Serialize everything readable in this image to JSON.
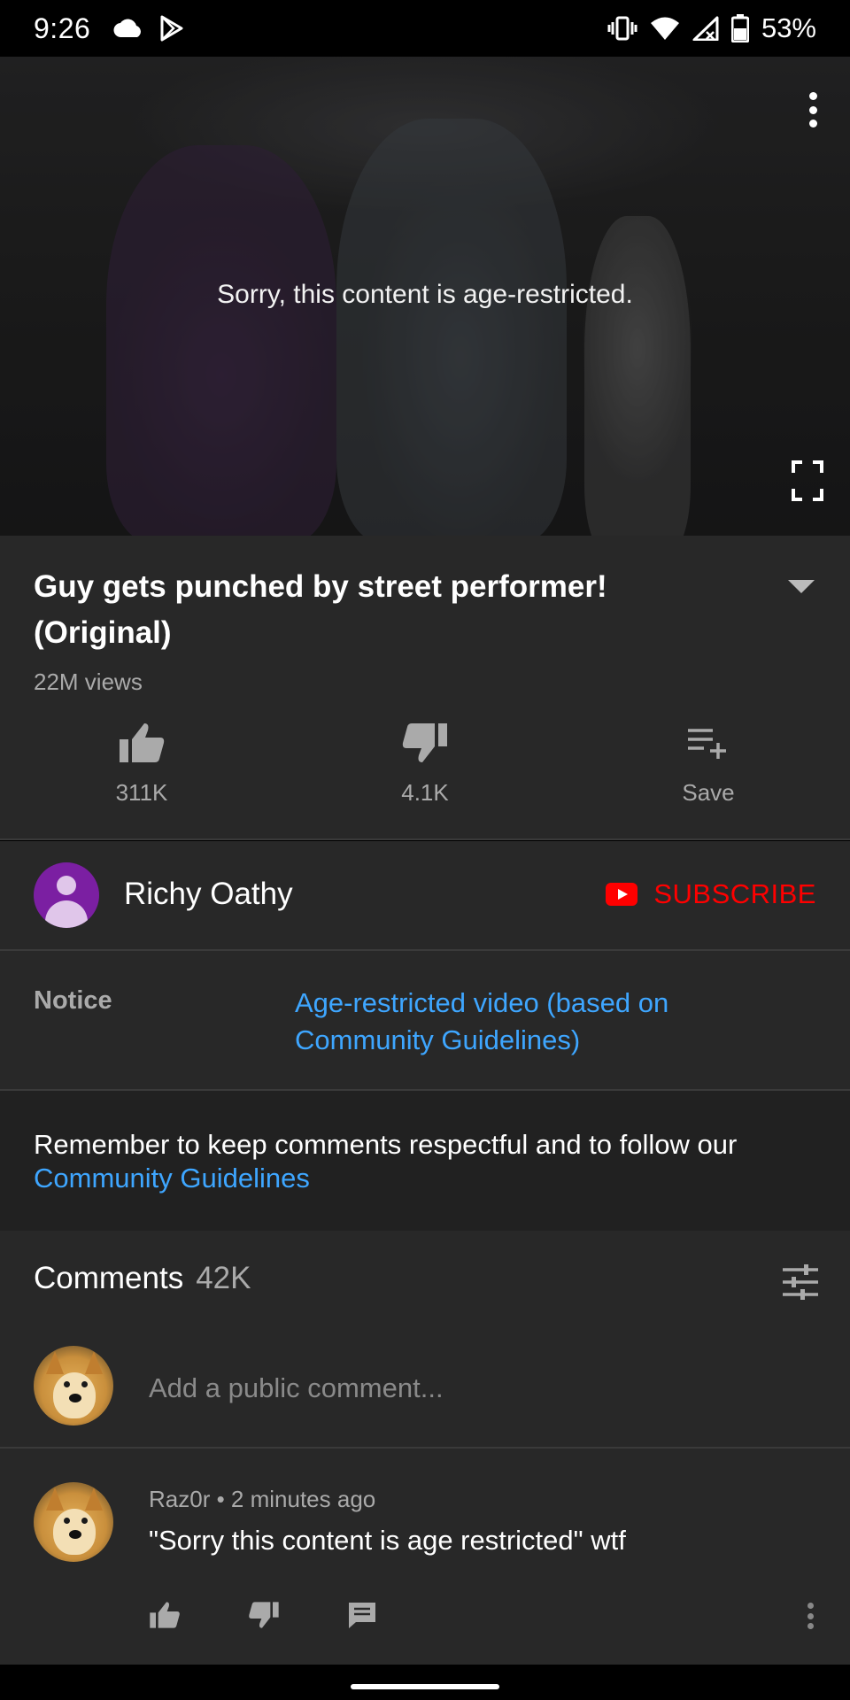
{
  "status_bar": {
    "time": "9:26",
    "battery": "53%",
    "icons": [
      "cloud-icon",
      "play-store-icon",
      "vibrate-icon",
      "wifi-icon",
      "signal-icon",
      "battery-icon"
    ]
  },
  "player": {
    "message": "Sorry, this content is age-restricted."
  },
  "video": {
    "title": "Guy gets punched by street performer! (Original)",
    "views": "22M views"
  },
  "actions": {
    "like": "311K",
    "dislike": "4.1K",
    "save": "Save"
  },
  "channel": {
    "name": "Richy Oathy",
    "subscribe": "SUBSCRIBE"
  },
  "notice": {
    "label": "Notice",
    "value": "Age-restricted video (based on Community Guidelines)"
  },
  "guidelines": {
    "text": "Remember to keep comments respectful and to follow our",
    "link": "Community Guidelines"
  },
  "comments": {
    "title": "Comments",
    "count": "42K",
    "placeholder": "Add a public comment...",
    "items": [
      {
        "author": "Raz0r",
        "time": "2 minutes ago",
        "text": "\"Sorry this content is age restricted\" wtf"
      }
    ]
  },
  "colors": {
    "accent_blue": "#3ea6ff",
    "subscribe_red": "#ff0000",
    "panel": "#282828",
    "channel_avatar": "#7b1fa2"
  }
}
